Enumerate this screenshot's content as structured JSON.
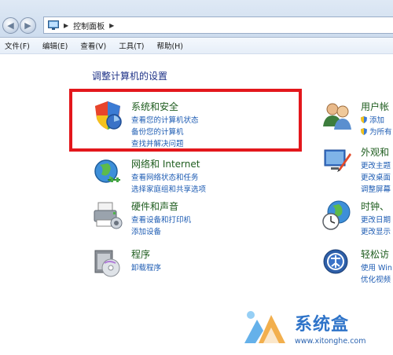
{
  "address_bar": {
    "breadcrumb_root": "控制面板",
    "back_label": "◀",
    "forward_label": "▶"
  },
  "menu": {
    "items": [
      "文件(F)",
      "编辑(E)",
      "查看(V)",
      "工具(T)",
      "帮助(H)"
    ]
  },
  "main": {
    "title": "调整计算机的设置",
    "categories": {
      "system_security": {
        "title": "系统和安全",
        "links": [
          "查看您的计算机状态",
          "备份您的计算机",
          "查找并解决问题"
        ]
      },
      "network": {
        "title": "网络和 Internet",
        "links": [
          "查看网络状态和任务",
          "选择家庭组和共享选项"
        ]
      },
      "hardware": {
        "title": "硬件和声音",
        "links": [
          "查看设备和打印机",
          "添加设备"
        ]
      },
      "programs": {
        "title": "程序",
        "links": [
          "卸载程序"
        ]
      },
      "user_accounts": {
        "title": "用户帐",
        "links": [
          "添加",
          "为所有"
        ]
      },
      "appearance": {
        "title": "外观和",
        "links": [
          "更改主题",
          "更改桌面",
          "调整屏幕"
        ]
      },
      "clock": {
        "title": "时钟、",
        "links": [
          "更改日期",
          "更改显示"
        ]
      },
      "ease_of_access": {
        "title": "轻松访",
        "links": [
          "使用 Win",
          "优化视频"
        ]
      }
    }
  },
  "watermark": {
    "text": "系统盒",
    "url": "www.xitonghe.com"
  },
  "colors": {
    "highlight_border": "#e3171c",
    "category_title": "#1e5c1e",
    "link": "#1e5cb3",
    "heading": "#1e3287"
  }
}
